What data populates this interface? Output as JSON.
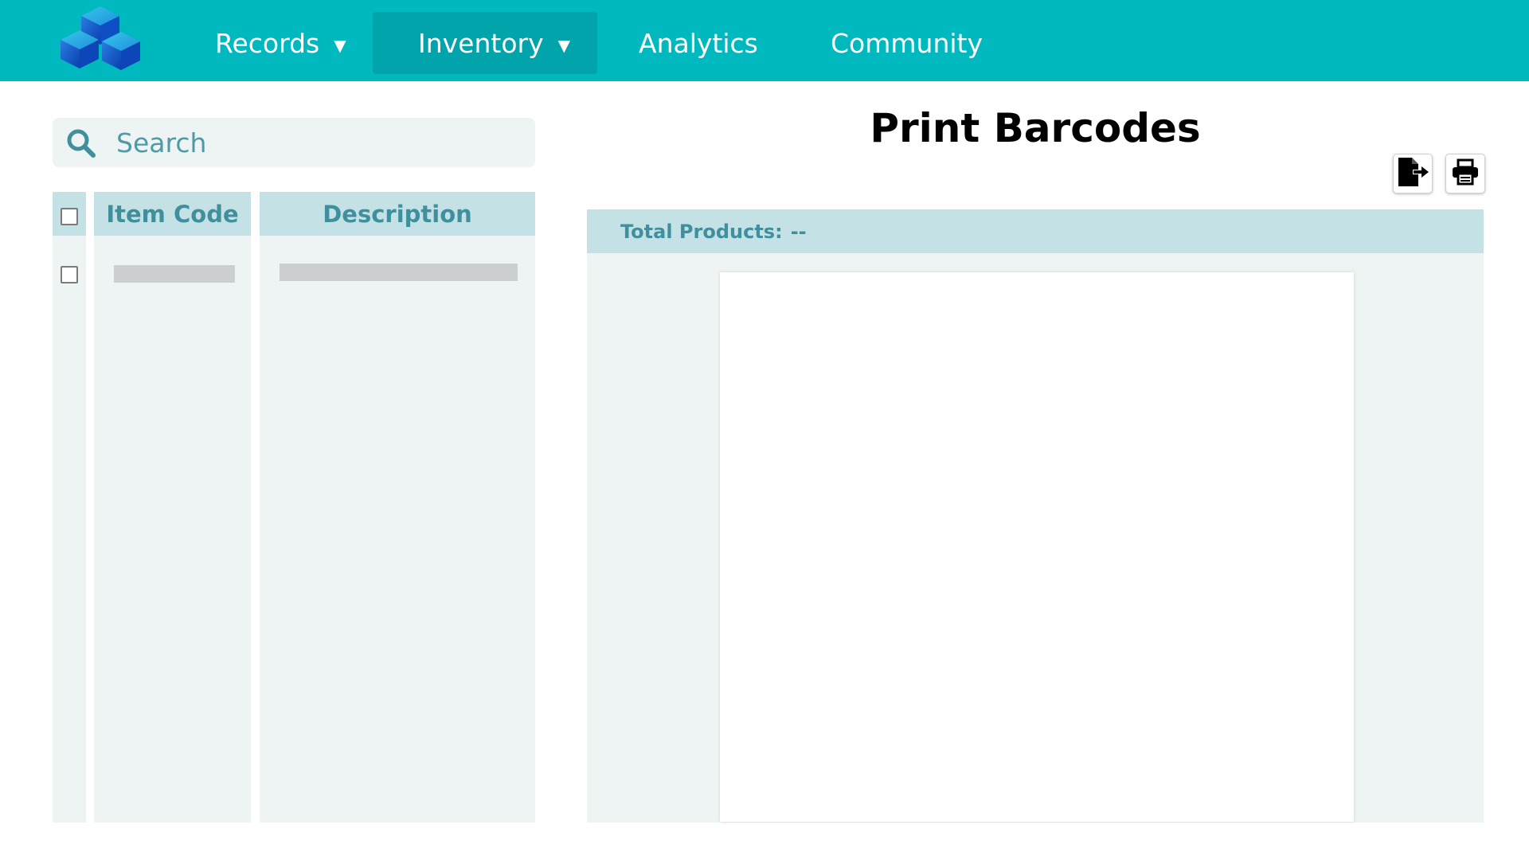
{
  "nav": {
    "logo_icon": "stacked-boxes-logo",
    "items": [
      {
        "label": "Records",
        "has_dropdown": true,
        "caret": "▼"
      },
      {
        "label": "Inventory",
        "has_dropdown": true,
        "caret": "▼",
        "active": true
      },
      {
        "label": "Analytics",
        "has_dropdown": false
      },
      {
        "label": "Community",
        "has_dropdown": false
      }
    ]
  },
  "search": {
    "placeholder": "Search",
    "value": "",
    "icon": "search-icon"
  },
  "table": {
    "columns": [
      "Item Code",
      "Description"
    ],
    "rows": [
      {
        "item_code": "",
        "description": "",
        "loading": true
      }
    ]
  },
  "main": {
    "title": "Print Barcodes",
    "toolbar": [
      {
        "icon": "file-export-icon"
      },
      {
        "icon": "printer-icon"
      }
    ],
    "total_products_label": "Total Products:",
    "total_products_value": "--"
  },
  "colors": {
    "nav_bg": "#00b9bf",
    "nav_active_bg": "#00a4aa",
    "panel_bg": "#eef3f3",
    "header_bg": "#c4e2e6",
    "header_text": "#3f8f9c",
    "skeleton": "#cccfd1"
  }
}
